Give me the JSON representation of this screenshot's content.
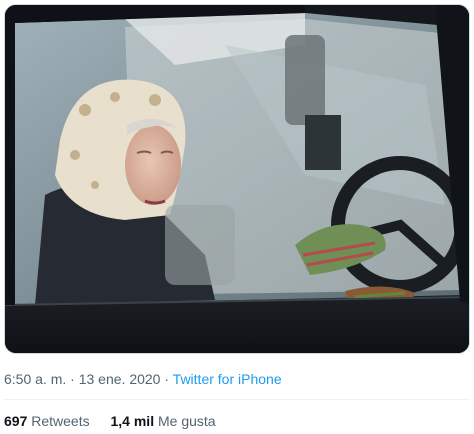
{
  "tweet": {
    "media": {
      "kind": "photo"
    },
    "time": "6:50 a. m.",
    "separator": "·",
    "date": "13 ene. 2020",
    "source": "Twitter for iPhone",
    "retweets": {
      "count": "697",
      "label": "Retweets"
    },
    "likes": {
      "count": "1,4 mil",
      "label": "Me gusta"
    }
  }
}
